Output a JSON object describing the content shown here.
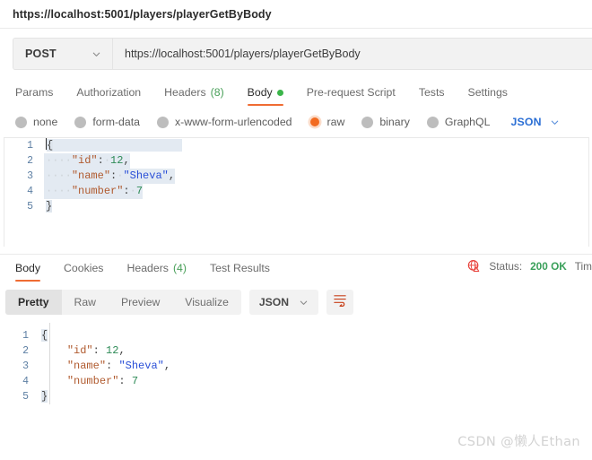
{
  "window": {
    "request_title": "https://localhost:5001/players/playerGetByBody"
  },
  "urlbar": {
    "method": "POST",
    "method_chevron_icon": "chevron-down-icon",
    "url": "https://localhost:5001/players/playerGetByBody"
  },
  "request_tabs": [
    {
      "label": "Params",
      "active": false
    },
    {
      "label": "Authorization",
      "active": false
    },
    {
      "label": "Headers",
      "count": "(8)",
      "active": false
    },
    {
      "label": "Body",
      "active": true,
      "dot": true
    },
    {
      "label": "Pre-request Script",
      "active": false
    },
    {
      "label": "Tests",
      "active": false
    },
    {
      "label": "Settings",
      "active": false
    }
  ],
  "body_types": [
    {
      "label": "none",
      "selected": false
    },
    {
      "label": "form-data",
      "selected": false
    },
    {
      "label": "x-www-form-urlencoded",
      "selected": false
    },
    {
      "label": "raw",
      "selected": true
    },
    {
      "label": "binary",
      "selected": false
    },
    {
      "label": "GraphQL",
      "selected": false
    }
  ],
  "body_format": {
    "label": "JSON",
    "chevron_icon": "chevron-down-icon"
  },
  "request_body": {
    "language": "json",
    "lines": [
      {
        "n": "1",
        "text": "{"
      },
      {
        "n": "2",
        "text": "    \"id\": 12,"
      },
      {
        "n": "3",
        "text": "    \"name\": \"Sheva\","
      },
      {
        "n": "4",
        "text": "    \"number\": 7"
      },
      {
        "n": "5",
        "text": "}"
      }
    ]
  },
  "response_tabs": [
    {
      "label": "Body",
      "active": true
    },
    {
      "label": "Cookies",
      "active": false
    },
    {
      "label": "Headers",
      "count": "(4)",
      "active": false
    },
    {
      "label": "Test Results",
      "active": false
    }
  ],
  "response_status": {
    "globe_icon": "globe-warning-icon",
    "status_label": "Status:",
    "status_value": "200 OK",
    "time_label": "Tim"
  },
  "response_toolbar": {
    "views": [
      {
        "label": "Pretty",
        "active": true
      },
      {
        "label": "Raw",
        "active": false
      },
      {
        "label": "Preview",
        "active": false
      },
      {
        "label": "Visualize",
        "active": false
      }
    ],
    "format": {
      "label": "JSON",
      "chevron_icon": "chevron-down-icon"
    },
    "wrap_button_icon": "word-wrap-icon"
  },
  "response_body": {
    "language": "json",
    "lines": [
      {
        "n": "1",
        "text": "{"
      },
      {
        "n": "2",
        "text": "    \"id\": 12,"
      },
      {
        "n": "3",
        "text": "    \"name\": \"Sheva\","
      },
      {
        "n": "4",
        "text": "    \"number\": 7"
      },
      {
        "n": "5",
        "text": "}"
      }
    ]
  },
  "watermark": {
    "text": "CSDN @懒人Ethan"
  },
  "colors": {
    "accent_orange": "#ef6c33",
    "status_green": "#3aa05a",
    "link_blue": "#2a6ed4",
    "selection_blue": "#e3eaf2"
  }
}
